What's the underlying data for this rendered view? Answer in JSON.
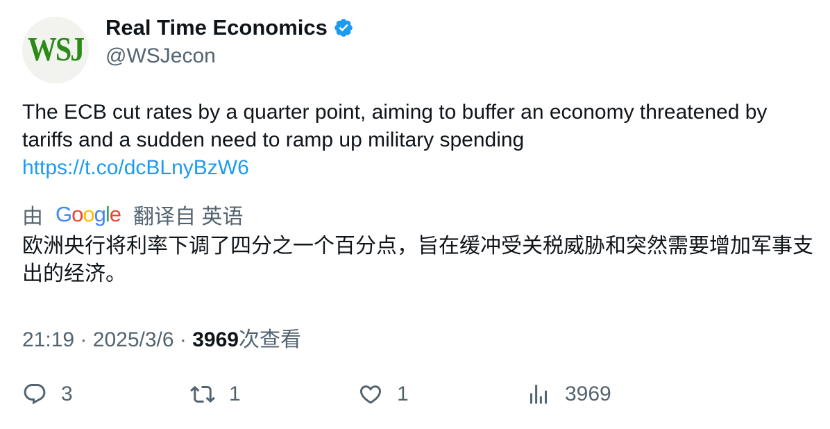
{
  "author": {
    "avatar_text": "WSJ",
    "display_name": "Real Time Economics",
    "handle": "@WSJecon",
    "verified_icon": "verified-badge-icon",
    "verified_color": "#1d9bf0"
  },
  "tweet": {
    "text": "The ECB cut rates by a quarter point, aiming to buffer an economy threatened by tariffs and a sudden need to ramp up military spending",
    "link": "https://t.co/dcBLnyBzW6"
  },
  "translation": {
    "prefix": "由",
    "provider": [
      "G",
      "o",
      "o",
      "g",
      "l",
      "e"
    ],
    "suffix": "翻译自 英语",
    "text": "欧洲央行将利率下调了四分之一个百分点，旨在缓冲受关税威胁和突然需要增加军事支出的经济。"
  },
  "meta": {
    "time": "21:19",
    "separator": "·",
    "date": "2025/3/6",
    "views": "3969",
    "views_label": "次查看"
  },
  "actions": {
    "reply_count": "3",
    "retweet_count": "1",
    "like_count": "1",
    "view_count": "3969"
  },
  "colors": {
    "link": "#1d9bf0",
    "secondary": "#536471",
    "primary": "#0f1419"
  }
}
